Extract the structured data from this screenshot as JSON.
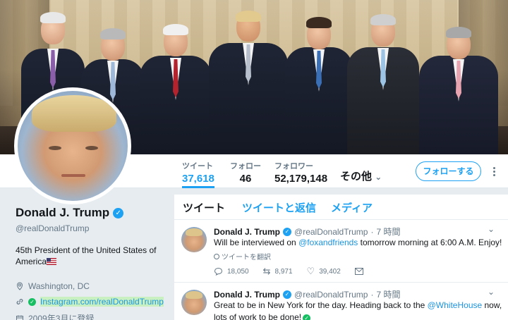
{
  "nav": {
    "stats": [
      {
        "label": "ツイート",
        "value": "37,618"
      },
      {
        "label": "フォロー",
        "value": "46"
      },
      {
        "label": "フォロワー",
        "value": "52,179,148"
      }
    ],
    "more_label": "その他",
    "follow_button": "フォローする"
  },
  "profile": {
    "name": "Donald J. Trump",
    "handle": "@realDonaldTrump",
    "bio": "45th President of the United States of America",
    "location": "Washington, DC",
    "website": "Instagram.com/realDonaldTrump",
    "joined": "2009年3月に登録"
  },
  "timeline": {
    "tabs": [
      "ツイート",
      "ツイートと返信",
      "メディア"
    ],
    "tweets": [
      {
        "name": "Donald J. Trump",
        "handle": "@realDonaldTrump",
        "dot": "·",
        "time": "7 時間",
        "text_before": "Will be interviewed on ",
        "link": "@foxandfriends",
        "text_after": " tomorrow morning at 6:00 A.M. Enjoy!",
        "translate": "ツイートを翻訳",
        "replies": "18,050",
        "retweets": "8,971",
        "likes": "39,402"
      },
      {
        "name": "Donald J. Trump",
        "handle": "@realDonaldTrump",
        "dot": "·",
        "time": "7 時間",
        "text_before": "Great to be in New York for the day. Heading back to the ",
        "link": "@WhiteHouse",
        "text_after": " now, lots of work to be done!"
      }
    ]
  },
  "colors": {
    "accent": "#1da1f2",
    "verified": "#1da1f2",
    "check": "#17bf63"
  }
}
